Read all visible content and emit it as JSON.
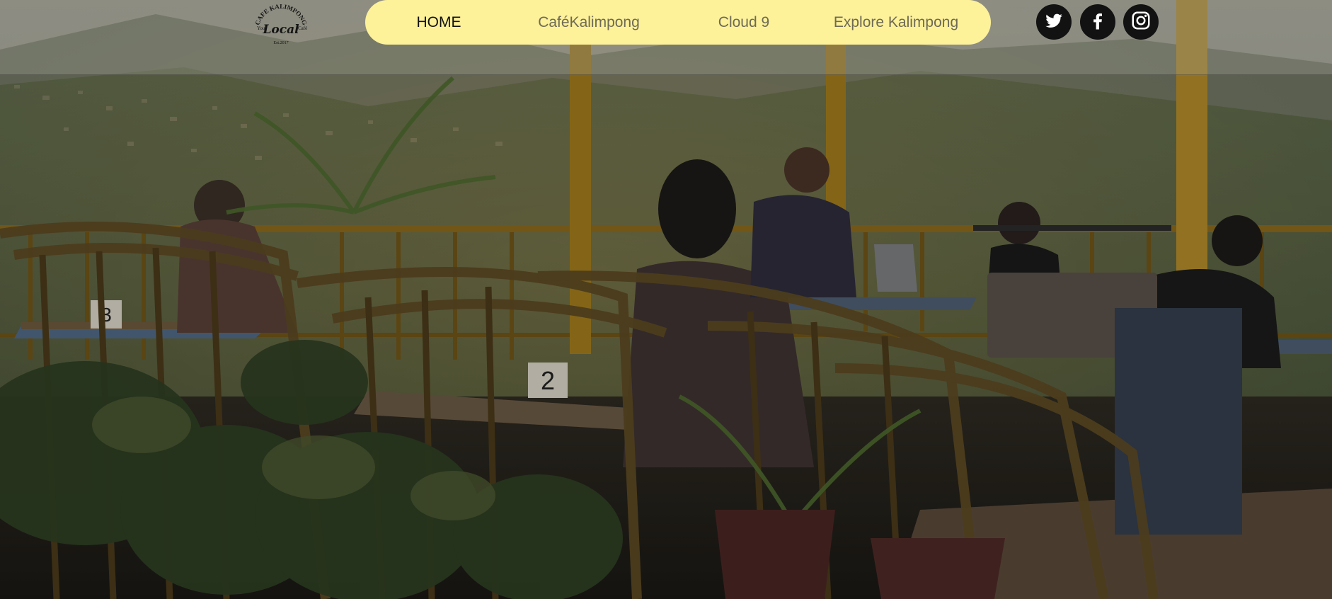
{
  "logo": {
    "arc_text": "CAFE KALIMPONG",
    "left_text": "Your",
    "center_text": "Local",
    "right_text": "Café",
    "est_text": "Est.2017"
  },
  "nav": {
    "items": [
      {
        "label": "HOME",
        "active": true
      },
      {
        "label": "CaféKalimpong",
        "active": false
      },
      {
        "label": "Cloud 9",
        "active": false
      },
      {
        "label": "Explore Kalimpong",
        "active": false
      }
    ],
    "background": "#fdf19a",
    "active_color": "#111111",
    "inactive_color": "#6e6a55"
  },
  "social": [
    {
      "name": "twitter",
      "icon": "twitter-icon"
    },
    {
      "name": "facebook",
      "icon": "facebook-icon"
    },
    {
      "name": "instagram",
      "icon": "instagram-icon"
    }
  ],
  "hero": {
    "table_numbers": [
      "3",
      "2"
    ]
  }
}
